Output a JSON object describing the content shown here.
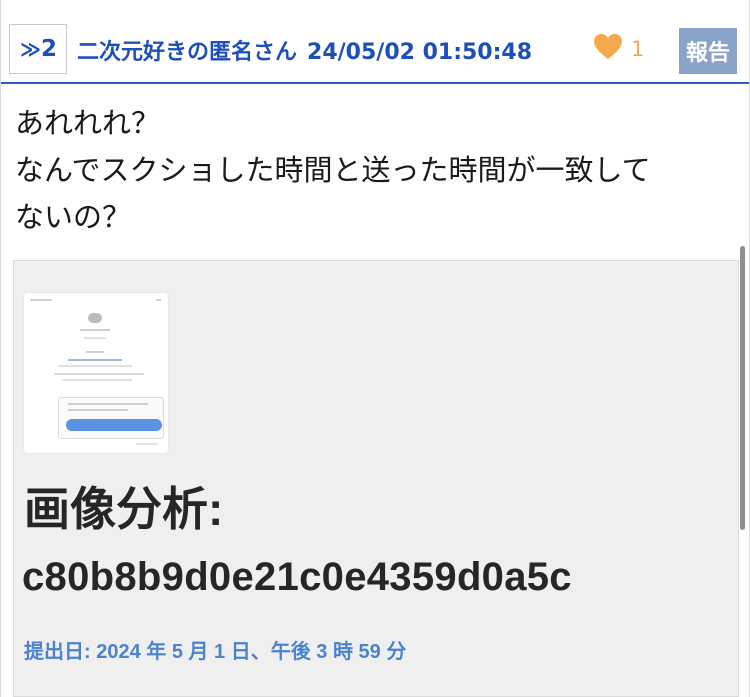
{
  "post": {
    "number_prefix": "≫",
    "number": "2",
    "author": "二次元好きの匿名さん",
    "date": "24/05/02 01:50:48",
    "like_icon": "heart-icon",
    "like_color": "#f5a94c",
    "like_count": "1",
    "report_label": "報告",
    "report_color": "#8aa3c9",
    "accent_color": "#1d4fb8",
    "body_lines": [
      "あれれれ？",
      "なんでスクショした時間と送った時間が一致して",
      "ないの？"
    ]
  },
  "attachment": {
    "title": "画像分析:",
    "hash": "c80b8b9d0e21c0e4359d0a5c",
    "submitted": "提出日: 2024 年 5 月 1 日、午後 3 時 59 分"
  }
}
